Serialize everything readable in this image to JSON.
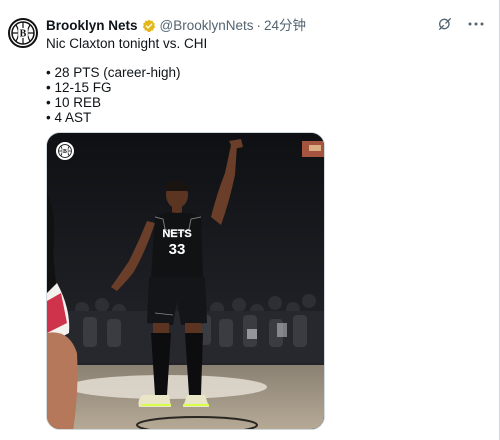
{
  "tweet": {
    "display_name": "Brooklyn Nets",
    "handle": "@BrooklynNets",
    "separator": "·",
    "timestamp": "24分钟",
    "lines": [
      "Nic Claxton tonight vs. CHI",
      "• 28 PTS (career-high)",
      "• 12-15 FG",
      "• 10 REB",
      "• 4 AST"
    ],
    "jersey": {
      "team_text": "NETS",
      "number": "33"
    }
  },
  "icons": {
    "avatar": "brooklyn-nets-logo",
    "verified": "verified-badge-icon",
    "grok": "grok-icon",
    "more": "more-icon"
  },
  "colors": {
    "verified_gold": "#e2b719",
    "text": "#0f1419",
    "secondary": "#536471"
  }
}
